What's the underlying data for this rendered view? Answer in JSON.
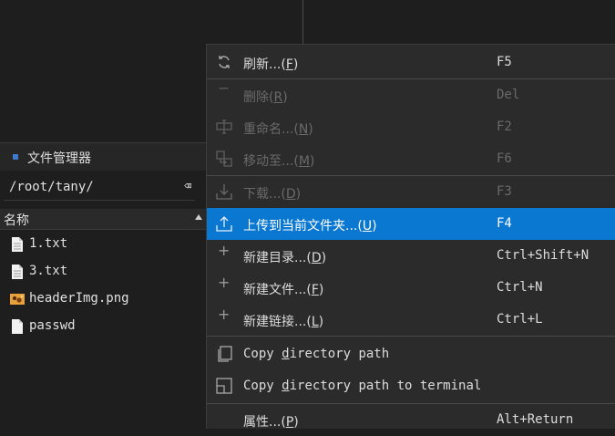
{
  "file_manager": {
    "title": "文件管理器",
    "path": "/root/tany/",
    "clear_glyph": "⌫",
    "column_header": "名称",
    "files": [
      {
        "name": "1.txt",
        "icon": "text-file-icon"
      },
      {
        "name": "3.txt",
        "icon": "text-file-icon"
      },
      {
        "name": "headerImg.png",
        "icon": "image-file-icon"
      },
      {
        "name": "passwd",
        "icon": "blank-file-icon"
      }
    ]
  },
  "context_menu": {
    "refresh": {
      "pre": "刷新...(",
      "key": "F",
      "post": ")",
      "shortcut": "F5"
    },
    "delete": {
      "pre": "删除(",
      "key": "R",
      "post": ")",
      "shortcut": "Del"
    },
    "rename": {
      "pre": "重命名...(",
      "key": "N",
      "post": ")",
      "shortcut": "F2"
    },
    "move": {
      "pre": "移动至...(",
      "key": "M",
      "post": ")",
      "shortcut": "F6"
    },
    "download": {
      "pre": "下载...(",
      "key": "D",
      "post": ")",
      "shortcut": "F3"
    },
    "upload": {
      "pre": "上传到当前文件夹...(",
      "key": "U",
      "post": ")",
      "shortcut": "F4"
    },
    "new_dir": {
      "pre": "新建目录...(",
      "key": "D",
      "post": ")",
      "shortcut": "Ctrl+Shift+N"
    },
    "new_file": {
      "pre": "新建文件...(",
      "key": "F",
      "post": ")",
      "shortcut": "Ctrl+N"
    },
    "new_link": {
      "pre": "新建链接...(",
      "key": "L",
      "post": ")",
      "shortcut": "Ctrl+L"
    },
    "copy_path": {
      "pre": "Copy ",
      "key": "d",
      "post": "irectory path"
    },
    "copy_path_terminal": {
      "pre": "Copy ",
      "key": "d",
      "post": "irectory path to terminal"
    },
    "properties": {
      "pre": "属性...(",
      "key": "P",
      "post": ")",
      "shortcut": "Alt+Return"
    }
  },
  "colors": {
    "highlight": "#0a77d1",
    "menu_bg": "#2b2b2b",
    "panel_bg": "#1e1e1e"
  }
}
